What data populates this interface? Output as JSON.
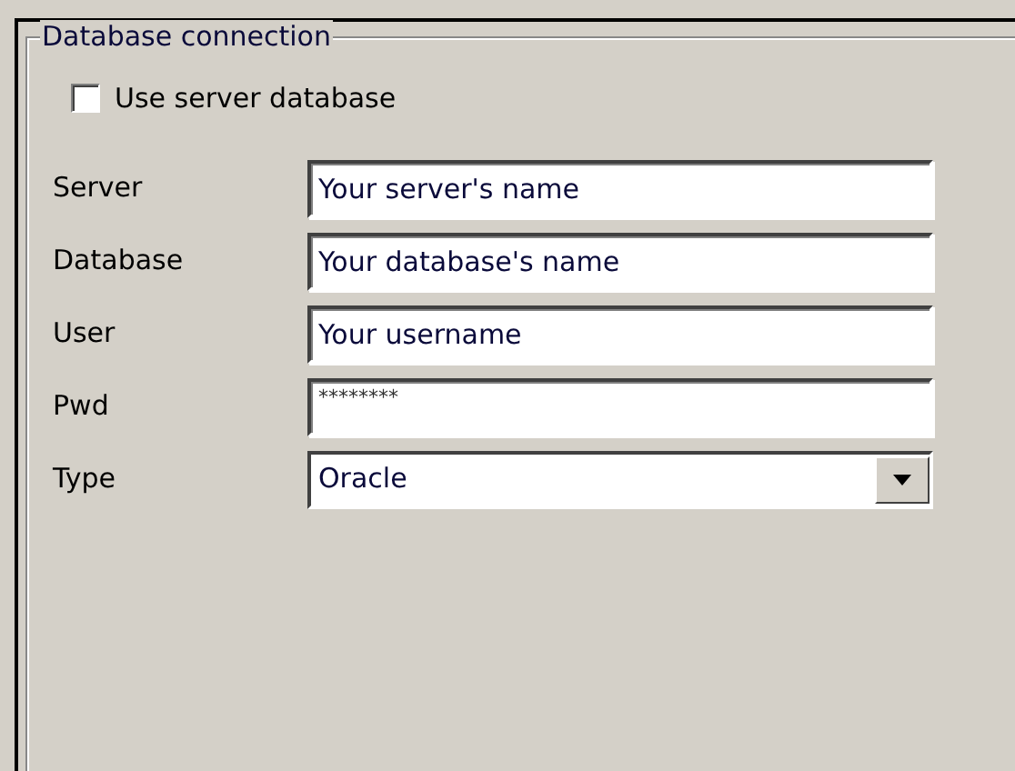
{
  "group": {
    "title": "Database connection"
  },
  "use_server": {
    "label": "Use server database",
    "checked": false
  },
  "fields": [
    {
      "kind": "text",
      "label": "Server",
      "value": "Your server's name"
    },
    {
      "kind": "text",
      "label": "Database",
      "value": "Your database's name"
    },
    {
      "kind": "text",
      "label": "User",
      "value": "Your username"
    },
    {
      "kind": "password",
      "label": "Pwd",
      "value": "********"
    },
    {
      "kind": "select",
      "label": "Type",
      "value": "Oracle"
    }
  ]
}
